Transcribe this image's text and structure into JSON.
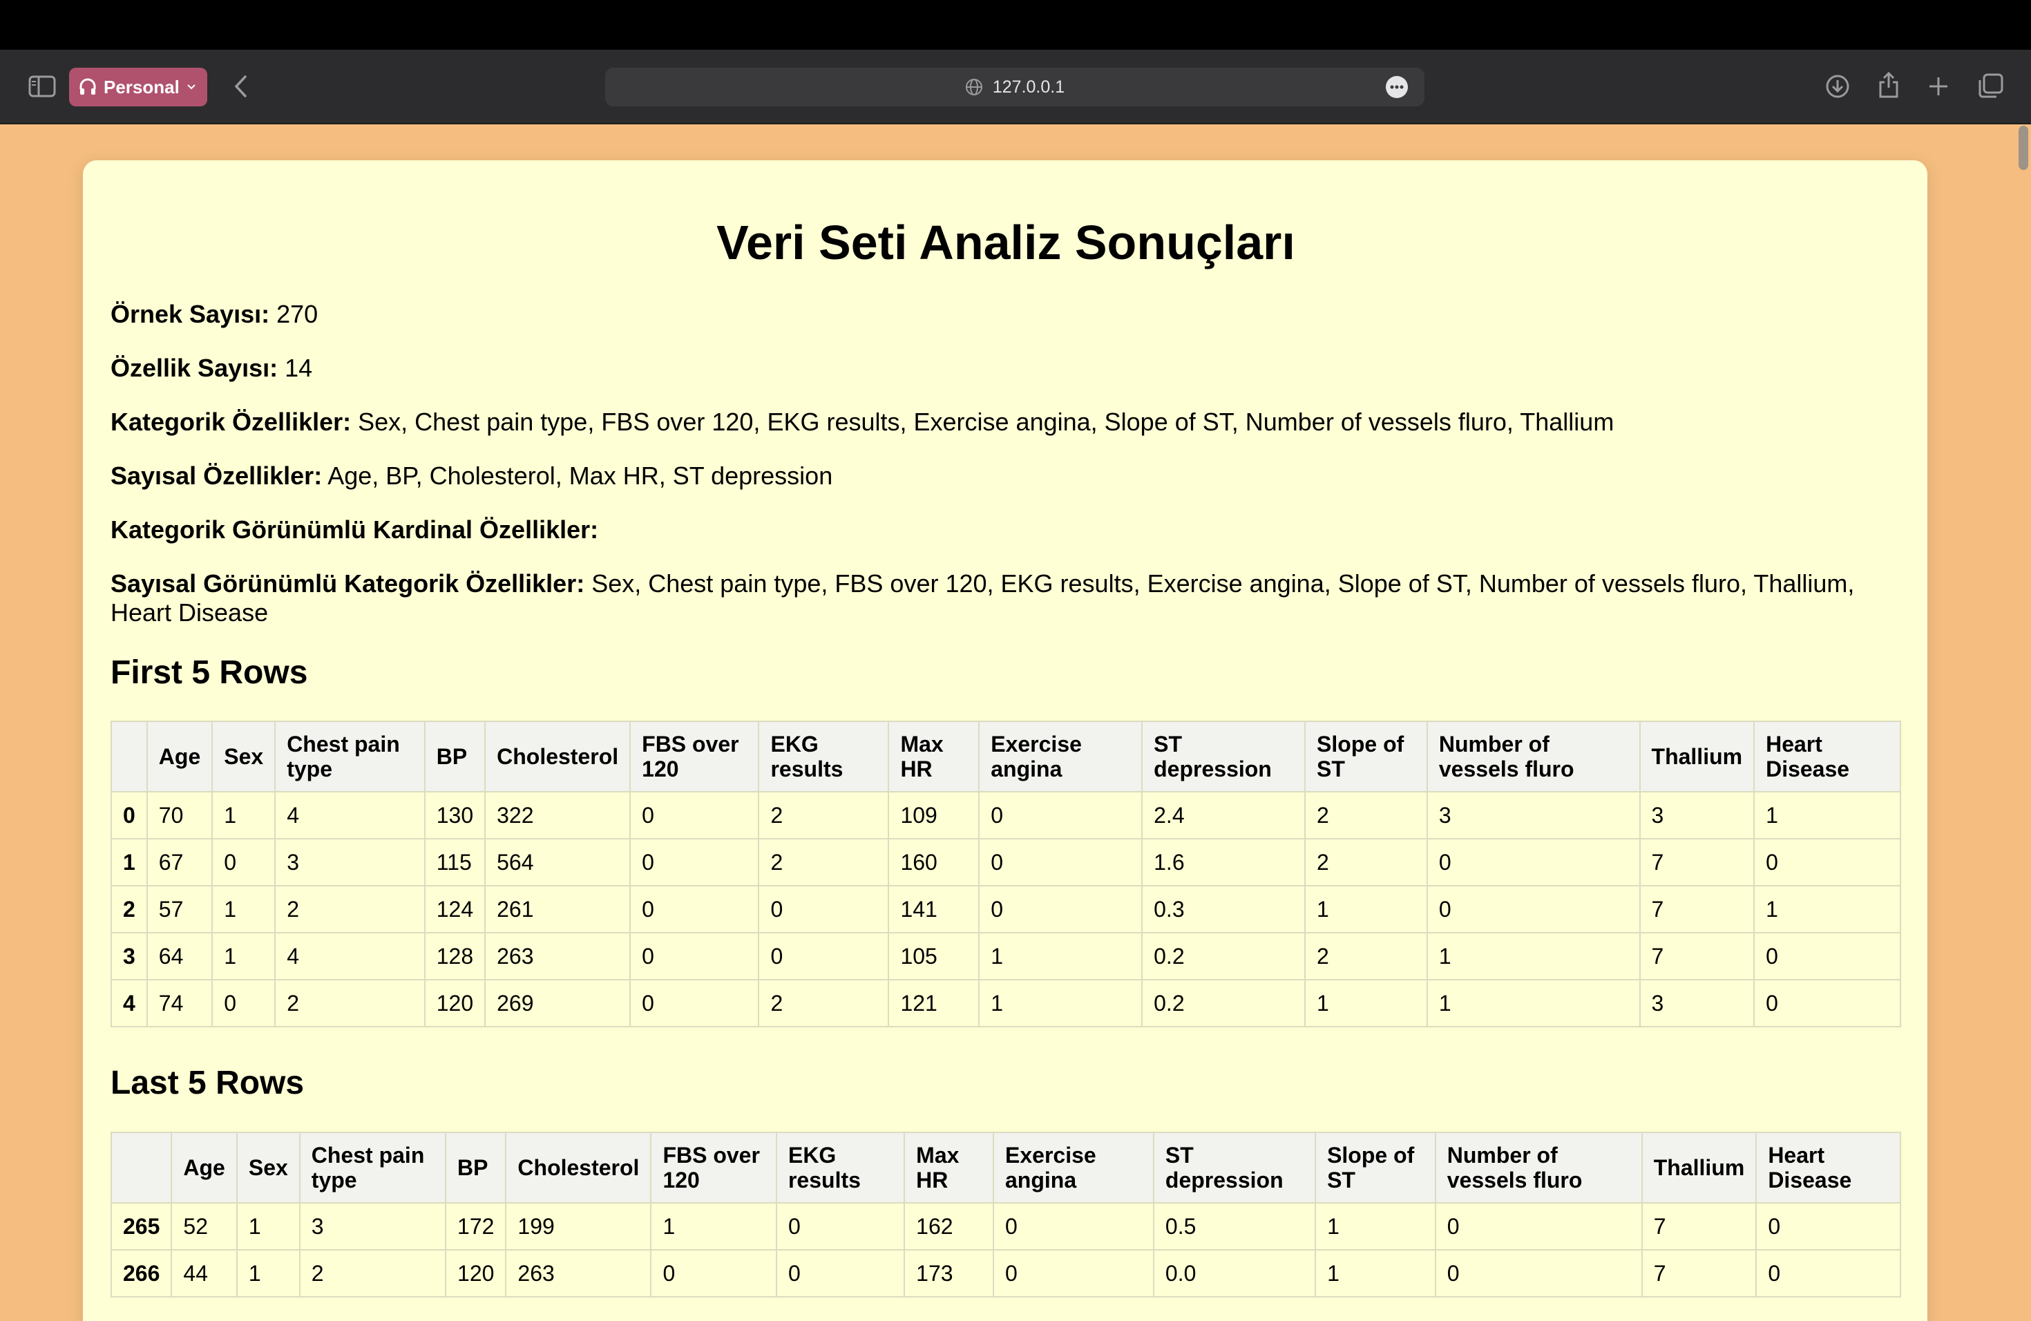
{
  "browser": {
    "profile_label": "Personal",
    "url": "127.0.0.1"
  },
  "page": {
    "title": "Veri Seti Analiz Sonuçları",
    "info": [
      {
        "label": "Örnek Sayısı:",
        "value": " 270"
      },
      {
        "label": "Özellik Sayısı:",
        "value": " 14"
      },
      {
        "label": "Kategorik Özellikler:",
        "value": " Sex, Chest pain type, FBS over 120, EKG results, Exercise angina, Slope of ST, Number of vessels fluro, Thallium"
      },
      {
        "label": "Sayısal Özellikler:",
        "value": " Age, BP, Cholesterol, Max HR, ST depression"
      },
      {
        "label": "Kategorik Görünümlü Kardinal Özellikler:",
        "value": ""
      },
      {
        "label": "Sayısal Görünümlü Kategorik Özellikler:",
        "value": " Sex, Chest pain type, FBS over 120, EKG results, Exercise angina, Slope of ST, Number of vessels fluro, Thallium, Heart Disease"
      }
    ],
    "first_heading": "First 5 Rows",
    "last_heading": "Last 5 Rows",
    "columns": [
      "",
      "Age",
      "Sex",
      "Chest pain type",
      "BP",
      "Cholesterol",
      "FBS over 120",
      "EKG results",
      "Max HR",
      "Exercise angina",
      "ST depression",
      "Slope of ST",
      "Number of vessels fluro",
      "Thallium",
      "Heart Disease"
    ],
    "first_rows": [
      [
        "0",
        "70",
        "1",
        "4",
        "130",
        "322",
        "0",
        "2",
        "109",
        "0",
        "2.4",
        "2",
        "3",
        "3",
        "1"
      ],
      [
        "1",
        "67",
        "0",
        "3",
        "115",
        "564",
        "0",
        "2",
        "160",
        "0",
        "1.6",
        "2",
        "0",
        "7",
        "0"
      ],
      [
        "2",
        "57",
        "1",
        "2",
        "124",
        "261",
        "0",
        "0",
        "141",
        "0",
        "0.3",
        "1",
        "0",
        "7",
        "1"
      ],
      [
        "3",
        "64",
        "1",
        "4",
        "128",
        "263",
        "0",
        "0",
        "105",
        "1",
        "0.2",
        "2",
        "1",
        "7",
        "0"
      ],
      [
        "4",
        "74",
        "0",
        "2",
        "120",
        "269",
        "0",
        "2",
        "121",
        "1",
        "0.2",
        "1",
        "1",
        "3",
        "0"
      ]
    ],
    "last_rows": [
      [
        "265",
        "52",
        "1",
        "3",
        "172",
        "199",
        "1",
        "0",
        "162",
        "0",
        "0.5",
        "1",
        "0",
        "7",
        "0"
      ],
      [
        "266",
        "44",
        "1",
        "2",
        "120",
        "263",
        "0",
        "0",
        "173",
        "0",
        "0.0",
        "1",
        "0",
        "7",
        "0"
      ]
    ]
  }
}
